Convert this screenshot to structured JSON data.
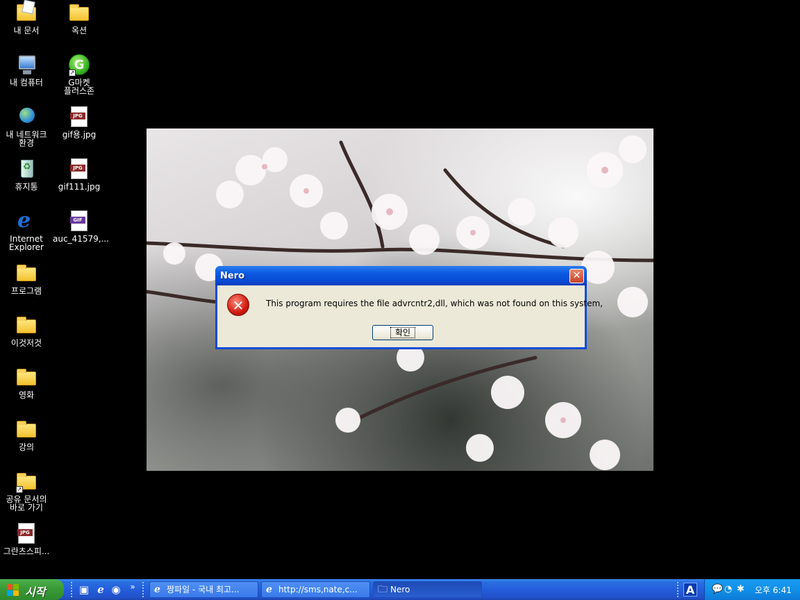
{
  "desktop": {
    "icons": [
      {
        "label": "내 문서"
      },
      {
        "label": "옥션"
      },
      {
        "label": "내 컴퓨터"
      },
      {
        "label": "G마켓\n플러스존"
      },
      {
        "label": "내 네트워크\n환경"
      },
      {
        "label": "gif용.jpg"
      },
      {
        "label": "휴지통"
      },
      {
        "label": "gif111.jpg"
      },
      {
        "label": "Internet\nExplorer"
      },
      {
        "label": "auc_41579,..."
      },
      {
        "label": "프로그램"
      },
      {
        "label": "이것저것"
      },
      {
        "label": "영화"
      },
      {
        "label": "강의"
      },
      {
        "label": "공유 문서의\n바로 가기"
      },
      {
        "label": "그란츠스피..."
      }
    ],
    "file_tags": {
      "jpg": "JPG",
      "gif": "GIF"
    },
    "g_letter": "G",
    "ie_letter": "e"
  },
  "dialog": {
    "title": "Nero",
    "close_glyph": "✕",
    "error_glyph": "✕",
    "message": "This program requires the file advrcntr2,dll, which was not found on this system,",
    "ok_label": "확인"
  },
  "taskbar": {
    "start_label": "시작",
    "quick_launch_more": "»",
    "tasks": [
      {
        "label": "짱파일 - 국내 최고...",
        "icon": "ie-icon"
      },
      {
        "label": "http://sms,nate,c...",
        "icon": "ie-icon"
      },
      {
        "label": "Nero",
        "icon": "folder-icon"
      }
    ],
    "language_indicator": "A",
    "clock": "오후 6:41"
  },
  "colors": {
    "titlebar": "#0a58e0",
    "dialog_bg": "#ece9d8",
    "taskbar": "#245edb",
    "start_green": "#3a9a38",
    "tray": "#1290e8"
  }
}
